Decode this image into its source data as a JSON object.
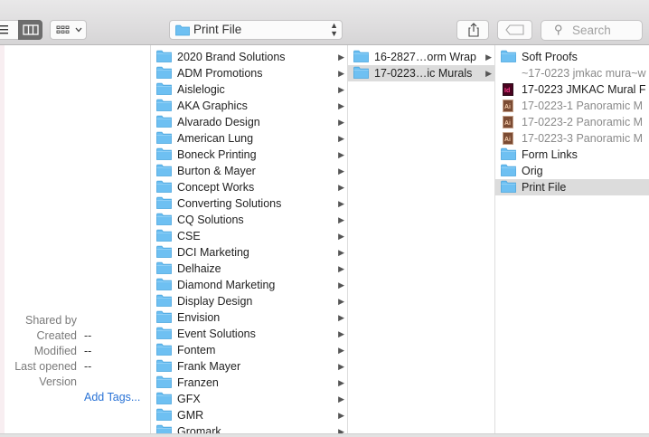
{
  "toolbar": {
    "path_label": "Print File",
    "search_placeholder": "Search"
  },
  "info": {
    "rows": [
      {
        "key": "Shared by",
        "value": ""
      },
      {
        "key": "Created",
        "value": "--"
      },
      {
        "key": "Modified",
        "value": "--"
      },
      {
        "key": "Last opened",
        "value": "--"
      },
      {
        "key": "Version",
        "value": ""
      }
    ],
    "add_tags": "Add Tags..."
  },
  "column1": [
    "2020 Brand Solutions",
    "ADM Promotions",
    "Aislelogic",
    "AKA Graphics",
    "Alvarado Design",
    "American Lung",
    "Boneck Printing",
    "Burton & Mayer",
    "Concept Works",
    "Converting Solutions",
    "CQ Solutions",
    "CSE",
    "DCI Marketing",
    "Delhaize",
    "Diamond Marketing",
    "Display Design",
    "Envision",
    "Event Solutions",
    "Fontem",
    "Frank Mayer",
    "Franzen",
    "GFX",
    "GMR",
    "Gromark"
  ],
  "column2": [
    {
      "label": "16-2827…orm Wrap",
      "selected": false
    },
    {
      "label": "17-0223…ic Murals",
      "selected": true
    }
  ],
  "column3": [
    {
      "label": "Soft Proofs",
      "type": "folder",
      "dim": false,
      "selected": false
    },
    {
      "label": "~17-0223 jmkac mura~w",
      "type": "blank",
      "dim": true,
      "selected": false
    },
    {
      "label": "17-0223 JMKAC Mural F",
      "type": "indesign",
      "dim": false,
      "selected": false
    },
    {
      "label": "17-0223-1 Panoramic M",
      "type": "ai",
      "dim": true,
      "selected": false
    },
    {
      "label": "17-0223-2 Panoramic M",
      "type": "ai",
      "dim": true,
      "selected": false
    },
    {
      "label": "17-0223-3 Panoramic M",
      "type": "ai",
      "dim": true,
      "selected": false
    },
    {
      "label": "Form Links",
      "type": "folder",
      "dim": false,
      "selected": false
    },
    {
      "label": "Orig",
      "type": "folder",
      "dim": false,
      "selected": false
    },
    {
      "label": "Print File",
      "type": "folder",
      "dim": false,
      "selected": true
    }
  ],
  "colors": {
    "folder": "#6ec0f2",
    "selection": "#dcdcdc",
    "link": "#2a73d6"
  }
}
